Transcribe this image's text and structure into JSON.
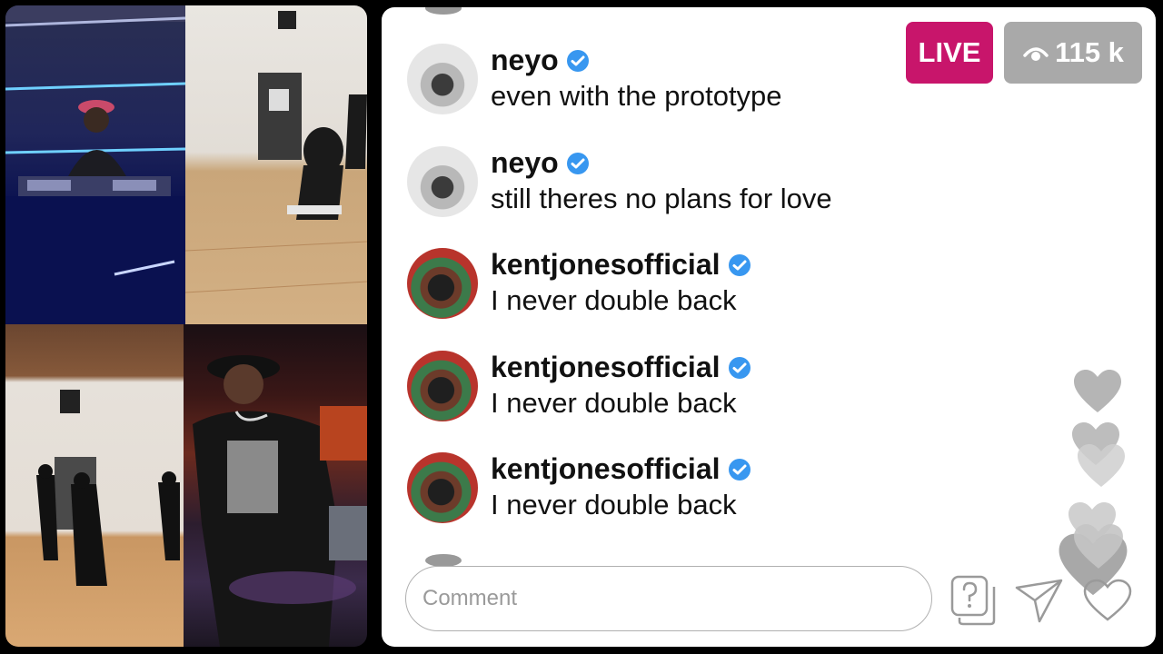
{
  "live": {
    "badge_label": "LIVE",
    "viewer_count": "115 k"
  },
  "comments": [
    {
      "username": "neyo",
      "message": "even with the prototype"
    },
    {
      "username": "neyo",
      "message": "still theres no plans for love"
    },
    {
      "username": "kentjonesofficial",
      "message": "I never double back"
    },
    {
      "username": "kentjonesofficial",
      "message": "I never double back"
    },
    {
      "username": "kentjonesofficial",
      "message": "I never double back"
    }
  ],
  "composer": {
    "placeholder": "Comment"
  },
  "colors": {
    "live": "#c8156b",
    "viewer_badge": "#a9a9a9",
    "verified": "#3897f0"
  },
  "icons": [
    "eye-icon",
    "verified-icon",
    "question-icon",
    "send-icon",
    "heart-icon"
  ]
}
